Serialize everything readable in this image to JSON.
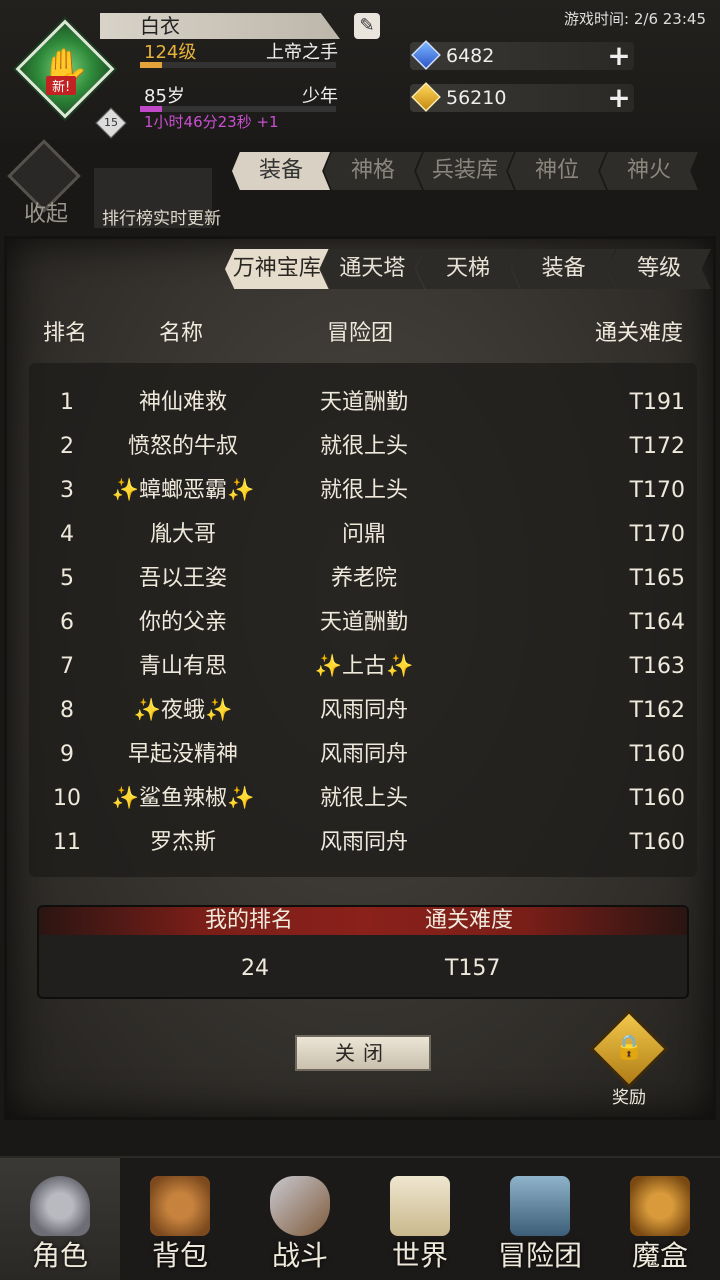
{
  "player": {
    "name": "白衣",
    "level": "124级",
    "title": "上帝之手",
    "age": "85岁",
    "stage": "少年",
    "timer": "1小时46分23秒 +1",
    "badge_new": "新!",
    "badge_level": "15",
    "xp_progress": 0.11,
    "age_progress": 0.11
  },
  "header": {
    "game_time": "游戏时间: 2/6 23:45",
    "gems": "6482",
    "gold": "56210"
  },
  "bg_tabs": [
    "装备",
    "神格",
    "兵装库",
    "神位",
    "神火"
  ],
  "collapse_label": "收起",
  "rank_notice": "排行榜实时更新",
  "sub_tabs": [
    "万神宝库",
    "通天塔",
    "天梯",
    "装备",
    "等级"
  ],
  "columns": {
    "rank": "排名",
    "name": "名称",
    "guild": "冒险团",
    "difficulty": "通关难度"
  },
  "rows": [
    {
      "rank": "1",
      "name": "神仙难救",
      "guild": "天道酬勤",
      "difficulty": "T191"
    },
    {
      "rank": "2",
      "name": "愤怒的牛叔",
      "guild": "就很上头",
      "difficulty": "T172"
    },
    {
      "rank": "3",
      "name": "✨蟑螂恶霸✨",
      "guild": "就很上头",
      "difficulty": "T170"
    },
    {
      "rank": "4",
      "name": "胤大哥",
      "guild": "问鼎",
      "difficulty": "T170"
    },
    {
      "rank": "5",
      "name": "吾以王姿",
      "guild": "养老院",
      "difficulty": "T165"
    },
    {
      "rank": "6",
      "name": "你的父亲",
      "guild": "天道酬勤",
      "difficulty": "T164"
    },
    {
      "rank": "7",
      "name": "青山有思",
      "guild": "✨上古✨",
      "difficulty": "T163"
    },
    {
      "rank": "8",
      "name": "✨夜蛾✨",
      "guild": "风雨同舟",
      "difficulty": "T162"
    },
    {
      "rank": "9",
      "name": "早起没精神",
      "guild": "风雨同舟",
      "difficulty": "T160"
    },
    {
      "rank": "10",
      "name": "✨鲨鱼辣椒✨",
      "guild": "就很上头",
      "difficulty": "T160"
    },
    {
      "rank": "11",
      "name": "罗杰斯",
      "guild": "风雨同舟",
      "difficulty": "T160"
    }
  ],
  "my_rank": {
    "rank_label": "我的排名",
    "difficulty_label": "通关难度",
    "rank": "24",
    "difficulty": "T157"
  },
  "close_label": "关闭",
  "reward_label": "奖励",
  "nav": [
    "角色",
    "背包",
    "战斗",
    "世界",
    "冒险团",
    "魔盒"
  ]
}
